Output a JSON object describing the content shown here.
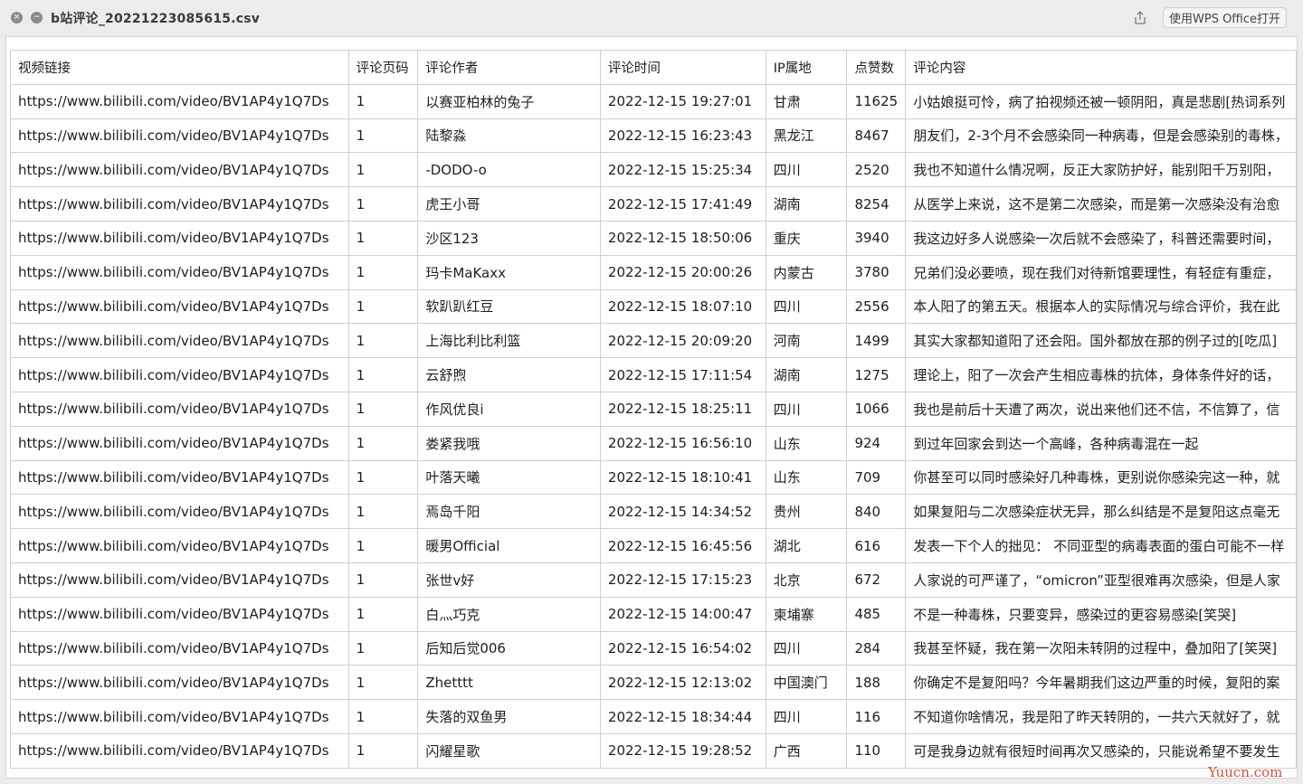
{
  "window": {
    "title": "b站评论_20221223085615.csv",
    "open_button": "使用WPS Office打开"
  },
  "table": {
    "headers": [
      "视频链接",
      "评论页码",
      "评论作者",
      "评论时间",
      "IP属地",
      "点赞数",
      "评论内容"
    ],
    "rows": [
      [
        "https://www.bilibili.com/video/BV1AP4y1Q7Ds",
        "1",
        "以赛亚柏林的兔子",
        "2022-12-15 19:27:01",
        "甘肃",
        "11625",
        "小姑娘挺可怜，病了拍视频还被一顿阴阳，真是悲剧[热词系列"
      ],
      [
        "https://www.bilibili.com/video/BV1AP4y1Q7Ds",
        "1",
        "陆黎淼",
        "2022-12-15 16:23:43",
        "黑龙江",
        "8467",
        "朋友们，2-3个月不会感染同一种病毒，但是会感染别的毒株，"
      ],
      [
        "https://www.bilibili.com/video/BV1AP4y1Q7Ds",
        "1",
        "-DODO-o",
        "2022-12-15 15:25:34",
        "四川",
        "2520",
        "我也不知道什么情况啊，反正大家防护好，能别阳千万别阳，"
      ],
      [
        "https://www.bilibili.com/video/BV1AP4y1Q7Ds",
        "1",
        "虎王小哥",
        "2022-12-15 17:41:49",
        "湖南",
        "8254",
        "从医学上来说，这不是第二次感染，而是第一次感染没有治愈"
      ],
      [
        "https://www.bilibili.com/video/BV1AP4y1Q7Ds",
        "1",
        "沙区123",
        "2022-12-15 18:50:06",
        "重庆",
        "3940",
        "我这边好多人说感染一次后就不会感染了，科普还需要时间，"
      ],
      [
        "https://www.bilibili.com/video/BV1AP4y1Q7Ds",
        "1",
        "玛卡MaKaxx",
        "2022-12-15 20:00:26",
        "内蒙古",
        "3780",
        "兄弟们没必要喷，现在我们对待新馆要理性，有轻症有重症，"
      ],
      [
        "https://www.bilibili.com/video/BV1AP4y1Q7Ds",
        "1",
        "软趴趴红豆",
        "2022-12-15 18:07:10",
        "四川",
        "2556",
        "本人阳了的第五天。根据本人的实际情况与综合评价，我在此"
      ],
      [
        "https://www.bilibili.com/video/BV1AP4y1Q7Ds",
        "1",
        "上海比利比利篮",
        "2022-12-15 20:09:20",
        "河南",
        "1499",
        "其实大家都知道阳了还会阳。国外都放在那的例子过的[吃瓜]"
      ],
      [
        "https://www.bilibili.com/video/BV1AP4y1Q7Ds",
        "1",
        "云舒煦",
        "2022-12-15 17:11:54",
        "湖南",
        "1275",
        "理论上，阳了一次会产生相应毒株的抗体，身体条件好的话，"
      ],
      [
        "https://www.bilibili.com/video/BV1AP4y1Q7Ds",
        "1",
        "作风优良i",
        "2022-12-15 18:25:11",
        "四川",
        "1066",
        "我也是前后十天遭了两次，说出来他们还不信，不信算了，信"
      ],
      [
        "https://www.bilibili.com/video/BV1AP4y1Q7Ds",
        "1",
        "娄紧我哦",
        "2022-12-15 16:56:10",
        "山东",
        "924",
        "到过年回家会到达一个高峰，各种病毒混在一起"
      ],
      [
        "https://www.bilibili.com/video/BV1AP4y1Q7Ds",
        "1",
        "叶落天曦",
        "2022-12-15 18:10:41",
        "山东",
        "709",
        "你甚至可以同时感染好几种毒株，更别说你感染完这一种，就"
      ],
      [
        "https://www.bilibili.com/video/BV1AP4y1Q7Ds",
        "1",
        "焉岛千阳",
        "2022-12-15 14:34:52",
        "贵州",
        "840",
        "如果复阳与二次感染症状无异，那么纠结是不是复阳这点毫无"
      ],
      [
        "https://www.bilibili.com/video/BV1AP4y1Q7Ds",
        "1",
        "暖男Official",
        "2022-12-15 16:45:56",
        "湖北",
        "616",
        "发表一下个人的拙见：  不同亚型的病毒表面的蛋白可能不一样"
      ],
      [
        "https://www.bilibili.com/video/BV1AP4y1Q7Ds",
        "1",
        "张世v好",
        "2022-12-15 17:15:23",
        "北京",
        "672",
        "人家说的可严谨了，“omicron”亚型很难再次感染，但是人家"
      ],
      [
        "https://www.bilibili.com/video/BV1AP4y1Q7Ds",
        "1",
        "白灬巧克",
        "2022-12-15 14:00:47",
        "柬埔寨",
        "485",
        "不是一种毒株，只要变异，感染过的更容易感染[笑哭]"
      ],
      [
        "https://www.bilibili.com/video/BV1AP4y1Q7Ds",
        "1",
        "后知后觉006",
        "2022-12-15 16:54:02",
        "四川",
        "284",
        "我甚至怀疑，我在第一次阳未转阴的过程中，叠加阳了[笑哭]"
      ],
      [
        "https://www.bilibili.com/video/BV1AP4y1Q7Ds",
        "1",
        "Zhetttt",
        "2022-12-15 12:13:02",
        "中国澳门",
        "188",
        "你确定不是复阳吗？今年暑期我们这边严重的时候，复阳的案"
      ],
      [
        "https://www.bilibili.com/video/BV1AP4y1Q7Ds",
        "1",
        "失落的双鱼男",
        "2022-12-15 18:34:44",
        "四川",
        "116",
        "不知道你啥情况，我是阳了昨天转阴的，一共六天就好了，就"
      ],
      [
        "https://www.bilibili.com/video/BV1AP4y1Q7Ds",
        "1",
        "闪耀星歌",
        "2022-12-15 19:28:52",
        "广西",
        "110",
        "可是我身边就有很短时间再次又感染的，只能说希望不要发生"
      ]
    ]
  },
  "watermark": "Yuucn.com",
  "icons": {
    "close": "close-icon",
    "minimize": "minimize-icon",
    "share": "share-icon"
  }
}
